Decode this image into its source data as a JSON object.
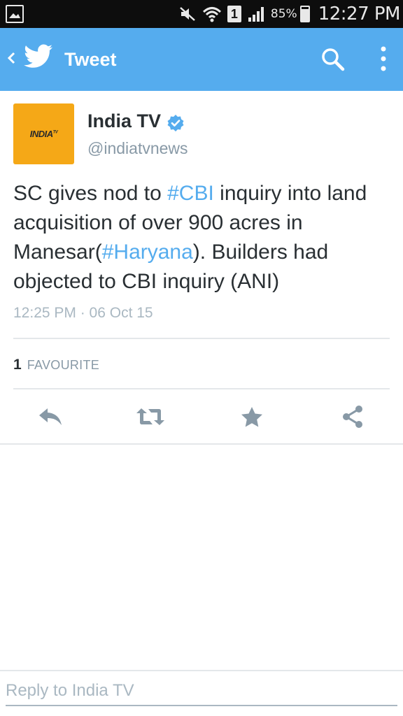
{
  "status_bar": {
    "battery_percent": "85%",
    "battery_level": 0.85,
    "sim_slot": "1",
    "time": "12:27 PM"
  },
  "app_bar": {
    "title": "Tweet",
    "icons": [
      "chevron-left-icon",
      "twitter-bird-icon",
      "search-icon",
      "more-vertical-icon"
    ],
    "color": "#55acee"
  },
  "tweet": {
    "author": {
      "name": "India TV",
      "handle": "@indiatvnews",
      "avatar_text": "INDIA",
      "avatar_sup": "TV",
      "avatar_color": "#f5a817",
      "verified": true
    },
    "text_parts": {
      "p1": "SC gives nod to ",
      "hashtag1": "#CBI",
      "p2": " inquiry into land acquisition of over 900 acres in Manesar(",
      "hashtag2": "#Haryana",
      "p3": "). Builders had objected to CBI inquiry (ANI)"
    },
    "timestamp": "12:25 PM · 06 Oct 15",
    "favourites": {
      "count": "1",
      "label": "FAVOURITE"
    },
    "actions": [
      "reply-icon",
      "retweet-icon",
      "favourite-star-icon",
      "share-icon"
    ]
  },
  "reply": {
    "placeholder": "Reply to India TV",
    "value": ""
  },
  "colors": {
    "link": "#55acee",
    "text": "#292f33",
    "muted": "#8899a6",
    "icon": "#8899a6"
  }
}
